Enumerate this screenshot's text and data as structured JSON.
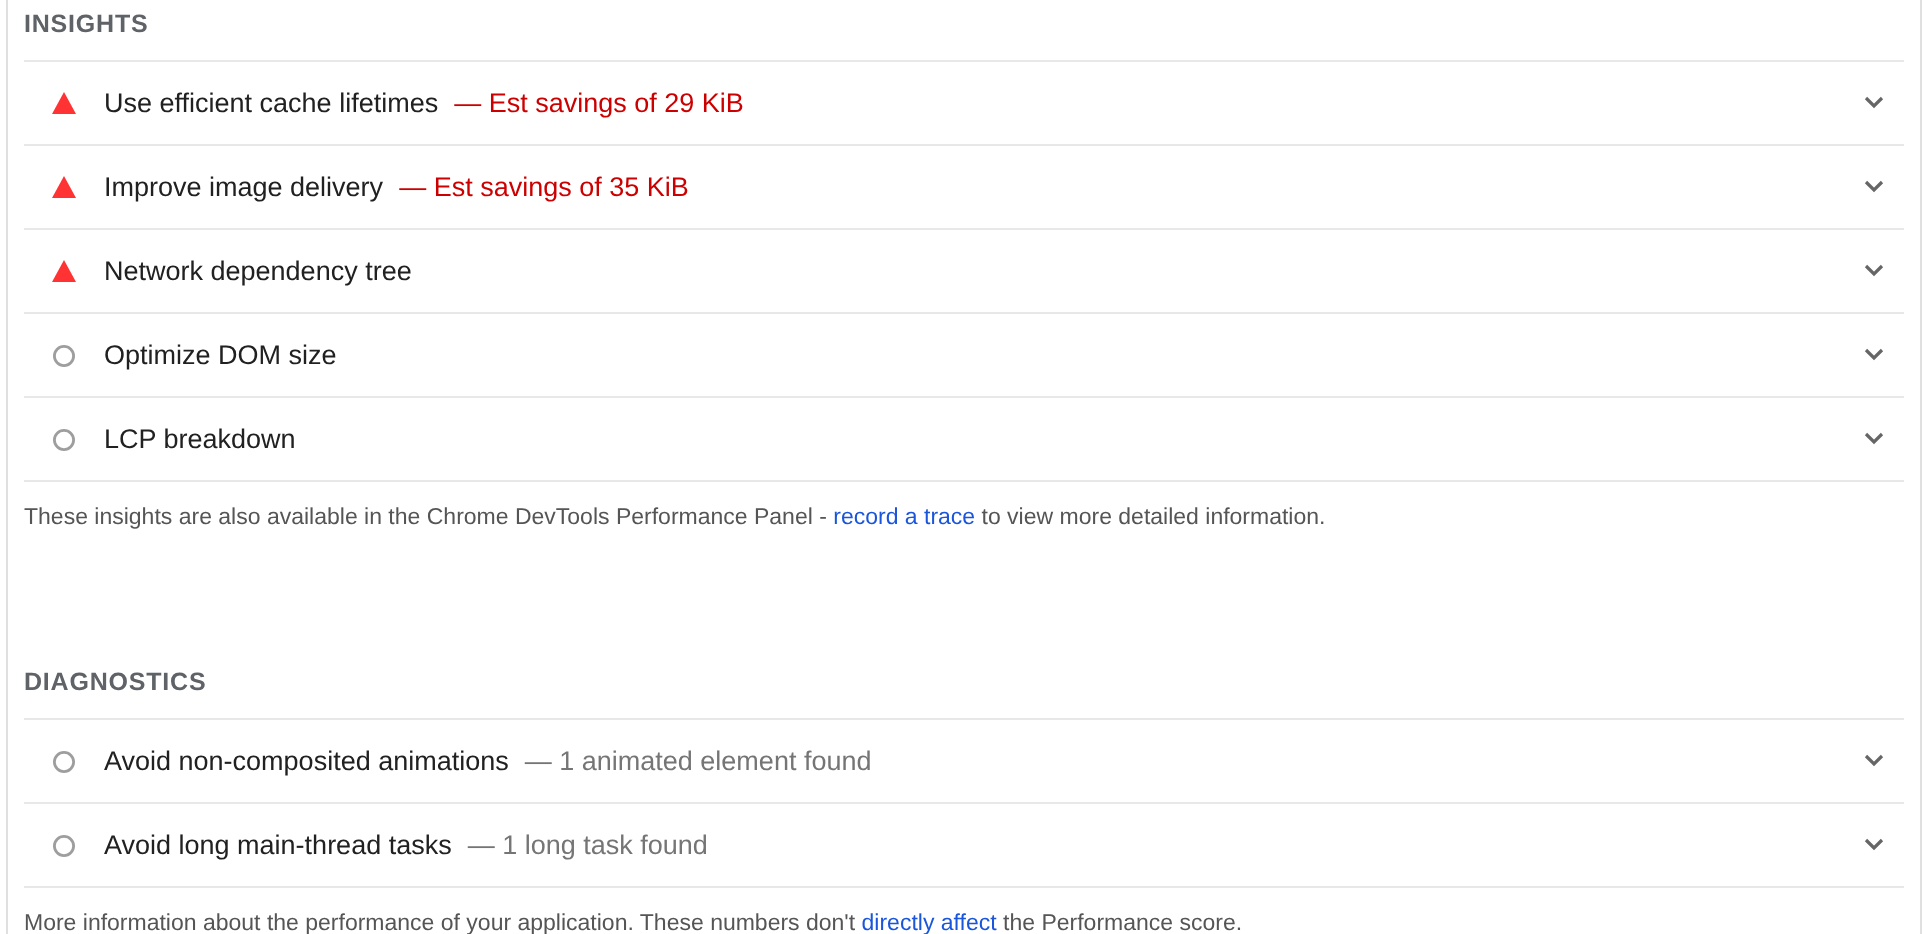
{
  "sections": [
    {
      "title": "INSIGHTS",
      "items": [
        {
          "kind": "fail",
          "title": "Use efficient cache lifetimes",
          "detail": "— Est savings of 29 KiB",
          "expanded": false
        },
        {
          "kind": "fail",
          "title": "Improve image delivery",
          "detail": "— Est savings of 35 KiB",
          "expanded": false
        },
        {
          "kind": "fail",
          "title": "Network dependency tree",
          "expanded": false
        },
        {
          "kind": "info",
          "title": "Optimize DOM size",
          "expanded": false
        },
        {
          "kind": "info",
          "title": "LCP breakdown",
          "expanded": false
        }
      ],
      "note": {
        "before": "These insights are also available in the Chrome DevTools Performance Panel - ",
        "link": "record a trace",
        "after": " to view more detailed information."
      }
    },
    {
      "title": "DIAGNOSTICS",
      "items": [
        {
          "kind": "info",
          "title": "Avoid non-composited animations",
          "detail": "— 1 animated element found",
          "expanded": false
        },
        {
          "kind": "info",
          "title": "Avoid long main-thread tasks",
          "detail": "— 1 long task found",
          "expanded": false
        }
      ],
      "note": {
        "before": "More information about the performance of your application. These numbers don't ",
        "link": "directly affect",
        "after": " the Performance score."
      }
    }
  ]
}
